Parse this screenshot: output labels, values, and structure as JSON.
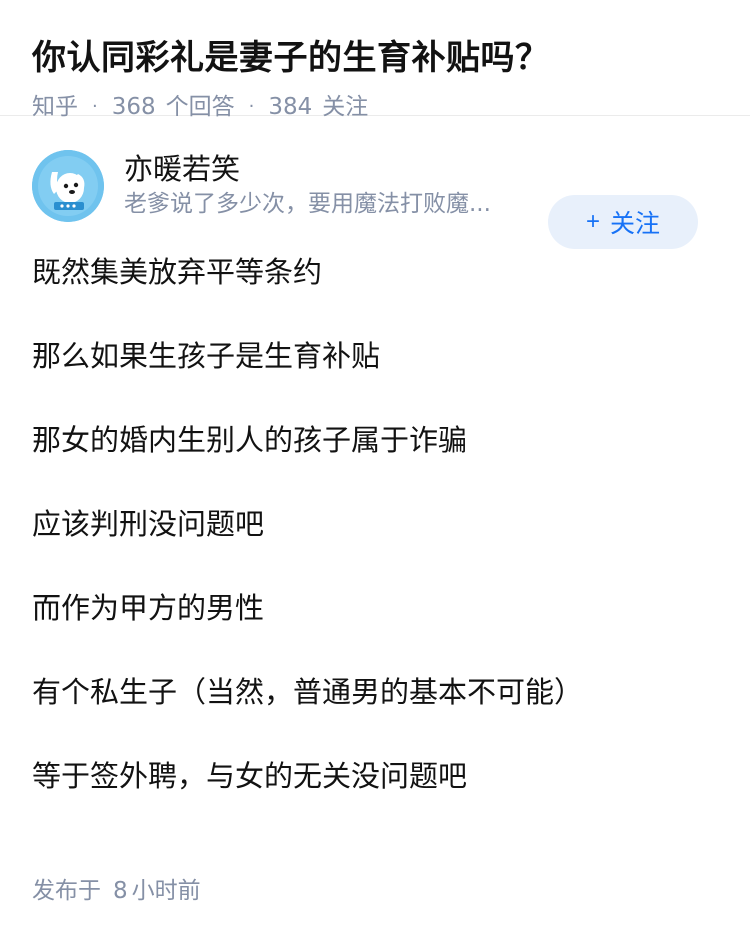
{
  "question": {
    "title": "你认同彩礼是妻子的生育补贴吗？",
    "source": "知乎",
    "answers_count": "368",
    "answers_label": "个回答",
    "followers_count": "384",
    "followers_label": "关注"
  },
  "author": {
    "name": "亦暖若笑",
    "bio": "老爹说了多少次，要用魔法打败魔...",
    "avatar_icon": "cartoon-dog-avatar",
    "follow_label": "关注",
    "follow_icon": "plus-icon",
    "accent_color": "#1772f6"
  },
  "answer": {
    "lines": [
      "既然集美放弃平等条约",
      "那么如果生孩子是生育补贴",
      "那女的婚内生别人的孩子属于诈骗",
      "应该判刑没问题吧",
      "而作为甲方的男性",
      "有个私生子（当然，普通男的基本不可能）",
      "等于签外聘，与女的无关没问题吧"
    ],
    "published_prefix": "发布于",
    "published_num": "8",
    "published_suffix": "小时前"
  }
}
